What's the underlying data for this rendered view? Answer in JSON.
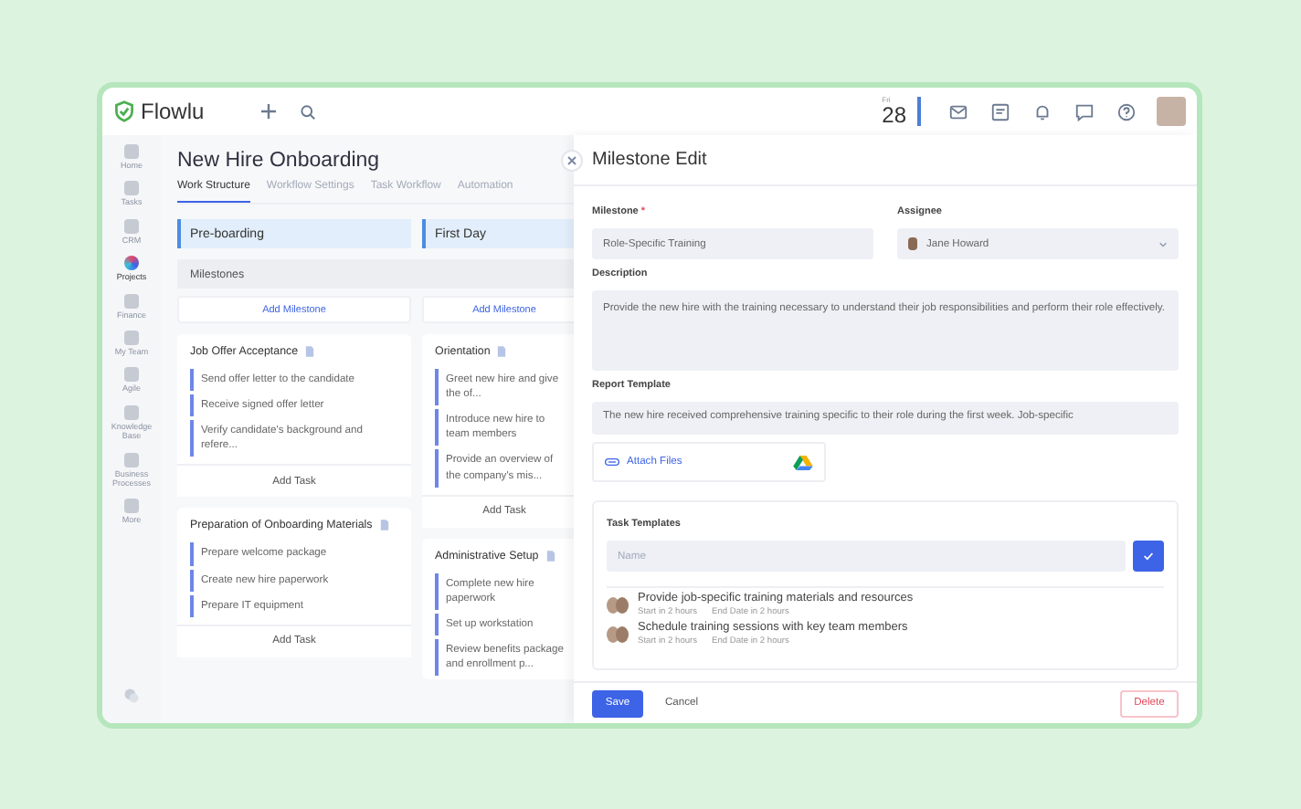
{
  "topbar": {
    "logo": "Flowlu",
    "day_name": "Fri",
    "day_number": "28"
  },
  "sidebar": {
    "items": [
      {
        "label": "Home",
        "selected": false
      },
      {
        "label": "Tasks",
        "selected": false
      },
      {
        "label": "CRM",
        "selected": false
      },
      {
        "label": "Projects",
        "selected": true
      },
      {
        "label": "Finance",
        "selected": false
      },
      {
        "label": "My Team",
        "selected": false
      },
      {
        "label": "Agile",
        "selected": false
      },
      {
        "label": "Knowledge Base",
        "selected": false
      },
      {
        "label": "Business Processes",
        "selected": false
      },
      {
        "label": "More",
        "selected": false
      }
    ]
  },
  "project": {
    "title": "New Hire Onboarding",
    "tabs": [
      {
        "label": "Work Structure",
        "selected": true
      },
      {
        "label": "Workflow Settings",
        "selected": false
      },
      {
        "label": "Task Workflow",
        "selected": false
      },
      {
        "label": "Automation",
        "selected": false
      }
    ],
    "milestones_label": "Milestones",
    "stages": [
      {
        "name": "Pre-boarding",
        "add_milestone": "Add Milestone",
        "milestones": [
          {
            "title": "Job Offer Acceptance",
            "tasks": [
              "Send offer letter to the candidate",
              "Receive signed offer letter",
              "Verify candidate's background and refere..."
            ],
            "add_task": "Add Task"
          },
          {
            "title": "Preparation of Onboarding Materials",
            "tasks": [
              "Prepare welcome package",
              "Create new hire paperwork",
              "Prepare IT equipment"
            ],
            "add_task": "Add Task"
          }
        ]
      },
      {
        "name": "First Day",
        "add_milestone": "Add Milestone",
        "milestones": [
          {
            "title": "Orientation",
            "tasks": [
              "Greet new hire and give the of...",
              "Introduce new hire to team members",
              "Provide an overview of the company's mis..."
            ],
            "add_task": "Add Task"
          },
          {
            "title": "Administrative Setup",
            "tasks": [
              "Complete new hire paperwork",
              "Set up workstation",
              "Review benefits package and enrollment p..."
            ]
          }
        ]
      }
    ]
  },
  "panel": {
    "title": "Milestone Edit",
    "milestone_label": "Milestone",
    "required_mark": "*",
    "milestone_value": "Role-Specific Training",
    "assignee_label": "Assignee",
    "assignee_value": "Jane Howard",
    "description_label": "Description",
    "description_value": "Provide the new hire with the training necessary to understand their job responsibilities and perform their role effectively.",
    "report_label": "Report Template",
    "report_value": "The new hire received comprehensive training specific to their role during the first week. Job-specific",
    "attach_label": "Attach Files",
    "templates_label": "Task Templates",
    "name_placeholder": "Name",
    "templates": [
      {
        "title": "Provide job-specific training materials and resources",
        "start": "Start in 2 hours",
        "end": "End Date in 2 hours"
      },
      {
        "title": "Schedule training sessions with key team members",
        "start": "Start in 2 hours",
        "end": "End Date in 2 hours"
      }
    ],
    "buttons": {
      "save": "Save",
      "cancel": "Cancel",
      "delete": "Delete"
    }
  }
}
